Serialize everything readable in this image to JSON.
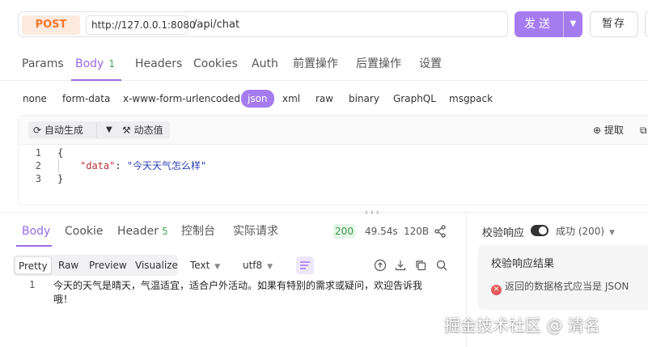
{
  "request": {
    "method": "POST",
    "host": "http://127.0.0.1:8080",
    "path": "/api/chat",
    "send_label": "发送",
    "save_label": "暂存"
  },
  "request_tabs": [
    {
      "label": "Params"
    },
    {
      "label": "Body",
      "count": "1"
    },
    {
      "label": "Headers"
    },
    {
      "label": "Cookies"
    },
    {
      "label": "Auth"
    },
    {
      "label": "前置操作"
    },
    {
      "label": "后置操作"
    },
    {
      "label": "设置"
    }
  ],
  "body_types": [
    "none",
    "form-data",
    "x-www-form-urlencoded",
    "json",
    "xml",
    "raw",
    "binary",
    "GraphQL",
    "msgpack"
  ],
  "editor": {
    "auto_generate": "自动生成",
    "dynamic_value": "动态值",
    "extract": "提取",
    "lines": [
      {
        "num": "1",
        "text": "{"
      },
      {
        "num": "2",
        "key": "\"data\"",
        "colon": ": ",
        "value": "\"今天天气怎么样\""
      },
      {
        "num": "3",
        "text": "}"
      }
    ]
  },
  "response": {
    "tabs": [
      {
        "label": "Body"
      },
      {
        "label": "Cookie"
      },
      {
        "label": "Header",
        "count": "5"
      },
      {
        "label": "控制台"
      },
      {
        "label": "实际请求"
      }
    ],
    "status": "200",
    "time": "49.54s",
    "size": "120B",
    "views": [
      "Pretty",
      "Raw",
      "Preview",
      "Visualize"
    ],
    "format": "Text",
    "encoding": "utf8",
    "line_num": "1",
    "text": "今天的天气是晴天，气温适宜，适合户外活动。如果有特别的需求或疑问，欢迎告诉我哦！"
  },
  "validation": {
    "label": "校验响应",
    "enabled": true,
    "expected": "成功 (200)",
    "result_title": "校验响应结果",
    "error": "返回的数据格式应当是 JSON"
  },
  "watermark": "掘金技术社区 @ 清名"
}
